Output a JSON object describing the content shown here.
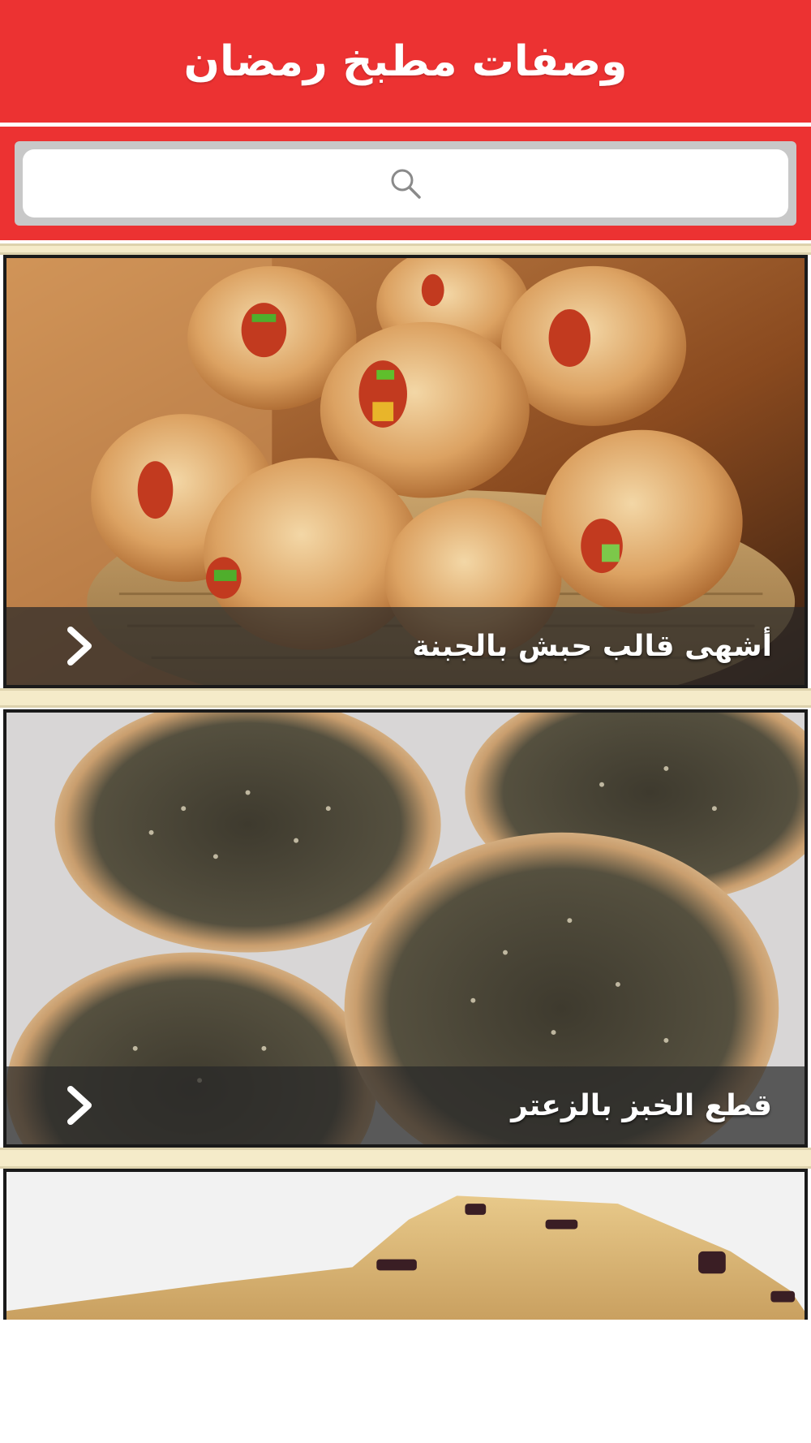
{
  "app": {
    "title": "وصفات مطبخ رمضان"
  },
  "search": {
    "placeholder": "",
    "icon": "search-icon"
  },
  "recipes": [
    {
      "title": "أشهى قالب حبش بالجبنة",
      "chevron_icon": "chevron-right-icon"
    },
    {
      "title": "قطع الخبز بالزعتر",
      "chevron_icon": "chevron-right-icon"
    },
    {
      "title": "",
      "chevron_icon": ""
    }
  ],
  "colors": {
    "header": "#ec3232",
    "separator": "#f5ebc9",
    "caption_bg": "rgba(40,40,40,0.72)"
  }
}
